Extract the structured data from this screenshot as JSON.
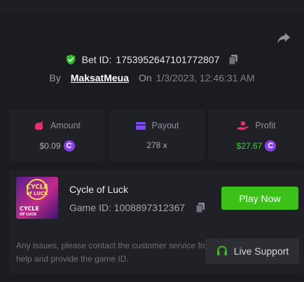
{
  "bet": {
    "id_label": "Bet ID:",
    "id_value": "1753952647101772807",
    "by_label": "By",
    "user": "MaksatMeua",
    "on_label": "On",
    "datetime": "1/3/2023, 12:46:31 AM"
  },
  "stats": {
    "amount": {
      "label": "Amount",
      "value": "$0.09"
    },
    "payout": {
      "label": "Payout",
      "value": "278 x"
    },
    "profit": {
      "label": "Profit",
      "value": "$27.67"
    }
  },
  "coin_symbol": "C",
  "game": {
    "name": "Cycle of Luck",
    "id_label": "Game ID:",
    "id_value": "1008897312367",
    "thumb_title_1": "CYCLE",
    "thumb_title_2": "of LUCK",
    "thumb_sub_1": "CYCLE",
    "thumb_sub_2": "OF LUCK",
    "play_label": "Play Now"
  },
  "support": {
    "notice": "Any issues, please contact the customer service for help and provide the game ID.",
    "button_label": "Live Support"
  },
  "colors": {
    "background": "#1b1c20",
    "card": "#202126",
    "accent_green": "#3bc117",
    "profit_green": "#3ed13e",
    "coin_purple": "#8a3ff0",
    "amount_icon": "#e0336a",
    "payout_icon": "#7d4cf0",
    "profit_icon": "#e0336a"
  },
  "icons": {
    "share": "share-icon",
    "shield": "shield-check-icon",
    "copy": "copy-icon",
    "amount": "bag-icon",
    "payout": "card-icon",
    "profit": "hand-coin-icon",
    "support": "headset-icon"
  }
}
